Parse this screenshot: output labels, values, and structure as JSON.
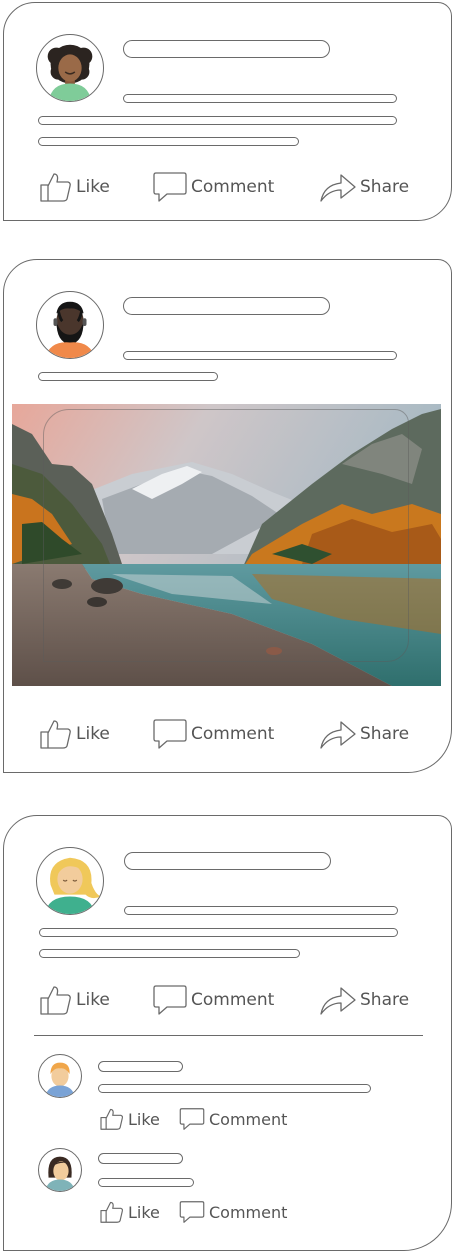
{
  "posts": [
    {
      "actions": {
        "like": "Like",
        "comment": "Comment",
        "share": "Share"
      }
    },
    {
      "actions": {
        "like": "Like",
        "comment": "Comment",
        "share": "Share"
      }
    },
    {
      "actions": {
        "like": "Like",
        "comment": "Comment",
        "share": "Share"
      },
      "comments": [
        {
          "actions": {
            "like": "Like",
            "comment": "Comment"
          }
        },
        {
          "actions": {
            "like": "Like",
            "comment": "Comment"
          }
        }
      ]
    }
  ],
  "icons": {
    "like": "thumbs-up-icon",
    "comment": "speech-bubble-icon",
    "share": "share-arrow-icon"
  },
  "colors": {
    "outline": "#6a6a6a",
    "text": "#555555"
  }
}
